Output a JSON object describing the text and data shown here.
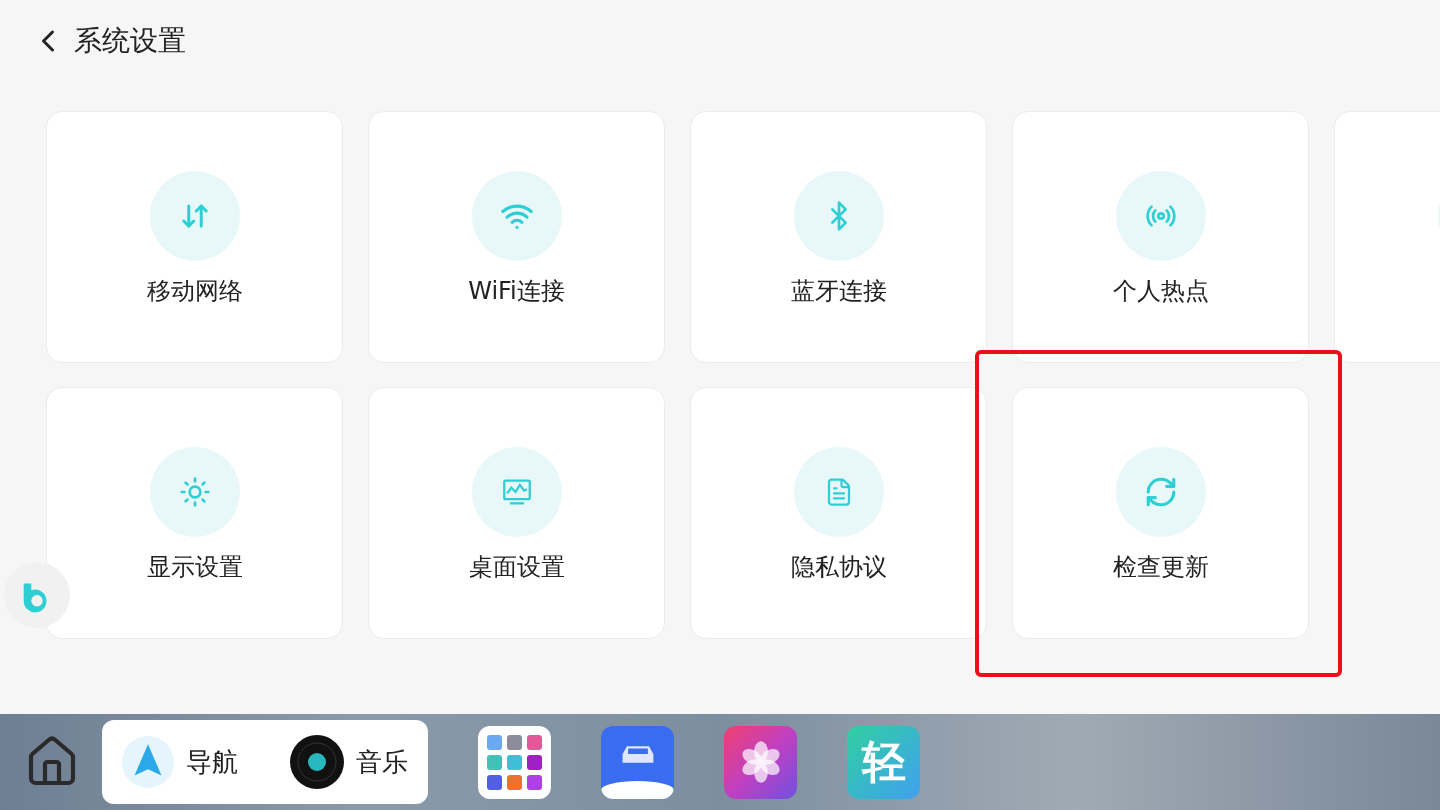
{
  "header": {
    "title": "系统设置"
  },
  "cards": [
    {
      "kind": "data",
      "label": "移动网络",
      "highlighted": false
    },
    {
      "kind": "wifi",
      "label": "WiFi连接",
      "highlighted": false
    },
    {
      "kind": "bluetooth",
      "label": "蓝牙连接",
      "highlighted": false
    },
    {
      "kind": "hotspot",
      "label": "个人热点",
      "highlighted": false
    },
    {
      "kind": "partial",
      "highlighted": false
    },
    {
      "kind": "display",
      "label": "显示设置",
      "highlighted": false
    },
    {
      "kind": "desktop",
      "label": "桌面设置",
      "highlighted": false
    },
    {
      "kind": "document",
      "label": "隐私协议",
      "highlighted": false
    },
    {
      "kind": "update",
      "label": "检查更新",
      "highlighted": true
    }
  ],
  "dock": {
    "widget": [
      {
        "kind": "navigation",
        "label": "导航"
      },
      {
        "kind": "music",
        "label": "音乐"
      }
    ],
    "apps": [
      {
        "kind": "folder"
      },
      {
        "kind": "car"
      },
      {
        "kind": "gallery"
      },
      {
        "kind": "text",
        "label": "轻"
      }
    ]
  }
}
